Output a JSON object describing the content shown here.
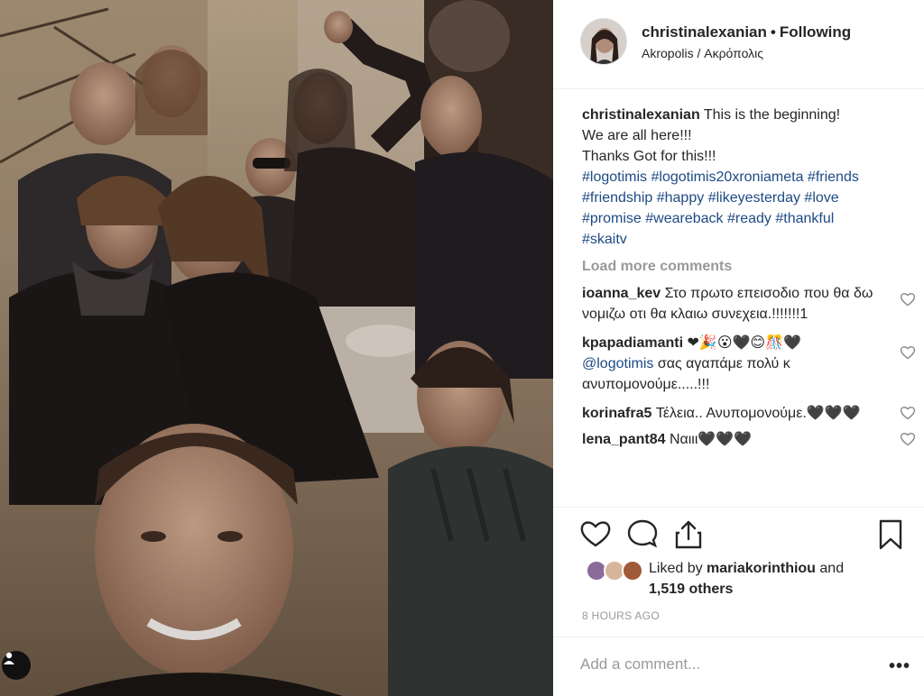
{
  "post": {
    "header": {
      "username": "christinalexanian",
      "follow_status": "Following",
      "location": "Akropolis / Ακρόπολις"
    },
    "caption": {
      "username": "christinalexanian",
      "line1": "This is the beginning!",
      "line2": "We are all here!!!",
      "line3": "Thanks Got for this!!!",
      "hashtags": [
        "#logotimis",
        "#logotimis20xroniameta",
        "#friends",
        "#friendship",
        "#happy",
        "#likeyesterday",
        "#love",
        "#promise",
        "#weareback",
        "#ready",
        "#thankful",
        "#skaitv"
      ]
    },
    "load_more": "Load more comments",
    "comments": [
      {
        "username": "ioanna_kev",
        "text": "Στο πρωτο επεισοδιο που θα δω νομιζω οτι θα κλαιω συνεχεια.!!!!!!!1"
      },
      {
        "username": "kpapadiamanti",
        "emoji": "❤🎉😮🖤😊🎊🖤",
        "mention": "@logotimis",
        "text": "σας αγαπάμε πολύ κ ανυπομονούμε.....!!!"
      },
      {
        "username": "korinafra5",
        "text": "Τέλεια.. Ανυπομονούμε.🖤🖤🖤"
      },
      {
        "username": "lena_pant84",
        "text": "Ναιιι🖤🖤🖤"
      }
    ],
    "likes": {
      "prefix": "Liked by",
      "liker": "mariakorinthiou",
      "joiner": "and",
      "others": "1,519 others"
    },
    "time_ago": "8 HOURS AGO",
    "comment_placeholder": "Add a comment...",
    "more_label": "•••"
  },
  "icons": {
    "like": "heart-icon",
    "comment": "speech-bubble-icon",
    "share": "share-icon",
    "save": "bookmark-icon",
    "tag": "person-tag-icon"
  },
  "colors": {
    "hashtag": "#1e4a84",
    "muted": "#999999",
    "text": "#262626"
  }
}
